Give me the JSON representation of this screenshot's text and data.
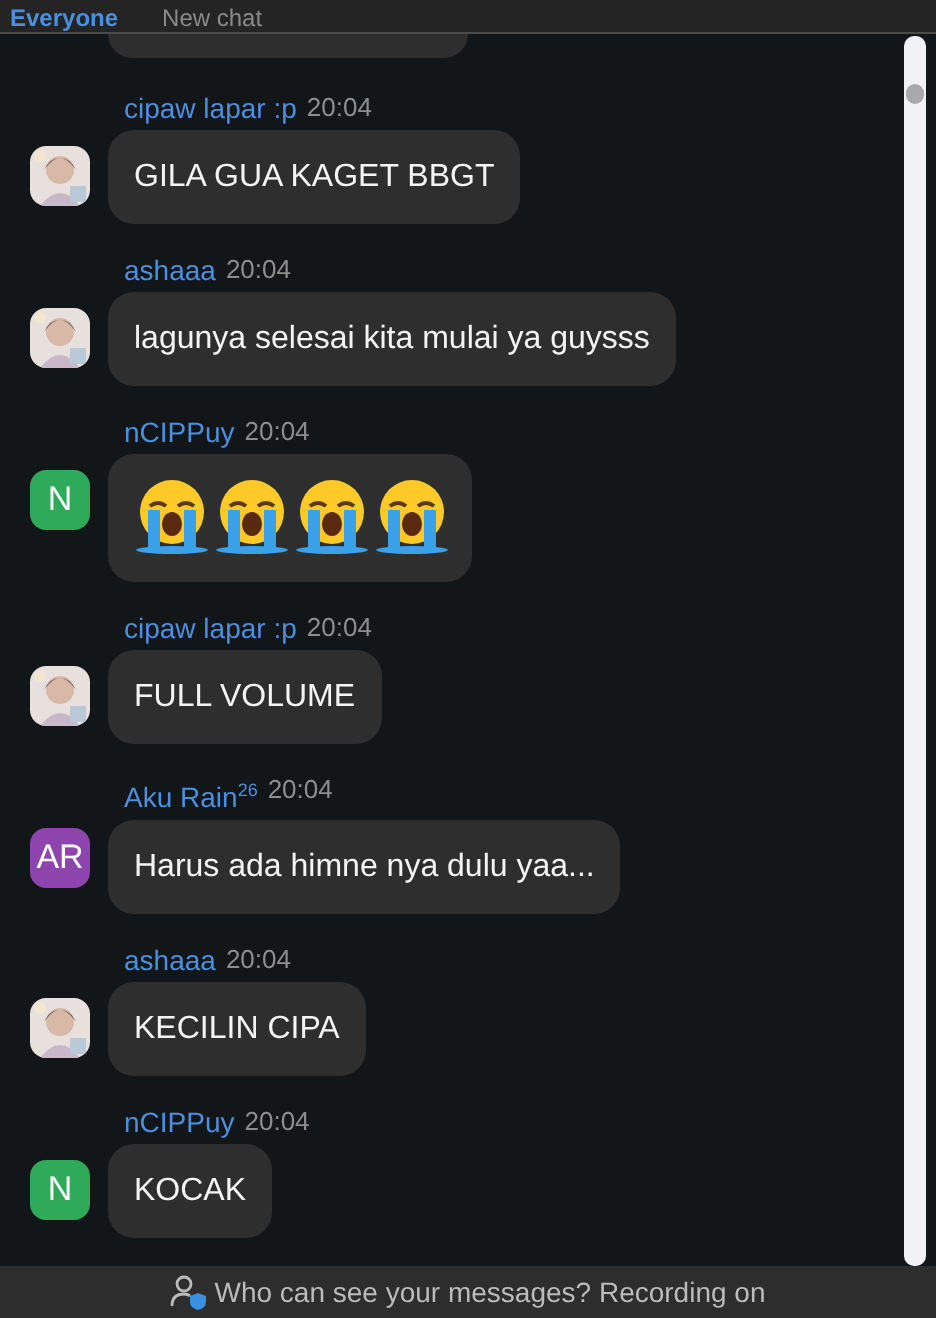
{
  "tabs": [
    {
      "label": "Everyone",
      "selected": true
    },
    {
      "label": "New chat",
      "selected": false
    }
  ],
  "messages": [
    {
      "kind": "cut"
    },
    {
      "kind": "text",
      "sender": "cipaw lapar :p",
      "time": "20:04",
      "text": "GILA GUA KAGET BBGT"
    },
    {
      "kind": "text",
      "sender": "ashaaa",
      "time": "20:04",
      "text": "lagunya selesai kita mulai ya guysss"
    },
    {
      "kind": "emoji",
      "sender": "nCIPPuy",
      "time": "20:04",
      "avatar": {
        "kind": "initials",
        "initials": "N",
        "color": "#2eaa5a"
      },
      "emojis": [
        {
          "kind": "loudly-crying"
        },
        {
          "kind": "loudly-crying"
        },
        {
          "kind": "loudly-crying"
        },
        {
          "kind": "loudly-crying"
        }
      ]
    },
    {
      "kind": "text",
      "sender": "cipaw lapar :p",
      "time": "20:04",
      "text": "FULL VOLUME"
    },
    {
      "kind": "text",
      "sender": "Aku Rain$^{26}$",
      "time": "20:04",
      "avatar": {
        "kind": "initials",
        "initials": "AR",
        "color": "#8e44ad"
      },
      "text": "Harus ada himne nya dulu yaa..."
    },
    {
      "kind": "text",
      "sender": "ashaaa",
      "time": "20:04",
      "text": "KECILIN CIPA"
    },
    {
      "kind": "text",
      "sender": "nCIPPuy",
      "time": "20:04",
      "avatar": {
        "kind": "initials",
        "initials": "N",
        "color": "#2eaa5a"
      },
      "text": "KOCAK"
    }
  ],
  "status_bar": {
    "text": "Who can see your messages? Recording on"
  }
}
